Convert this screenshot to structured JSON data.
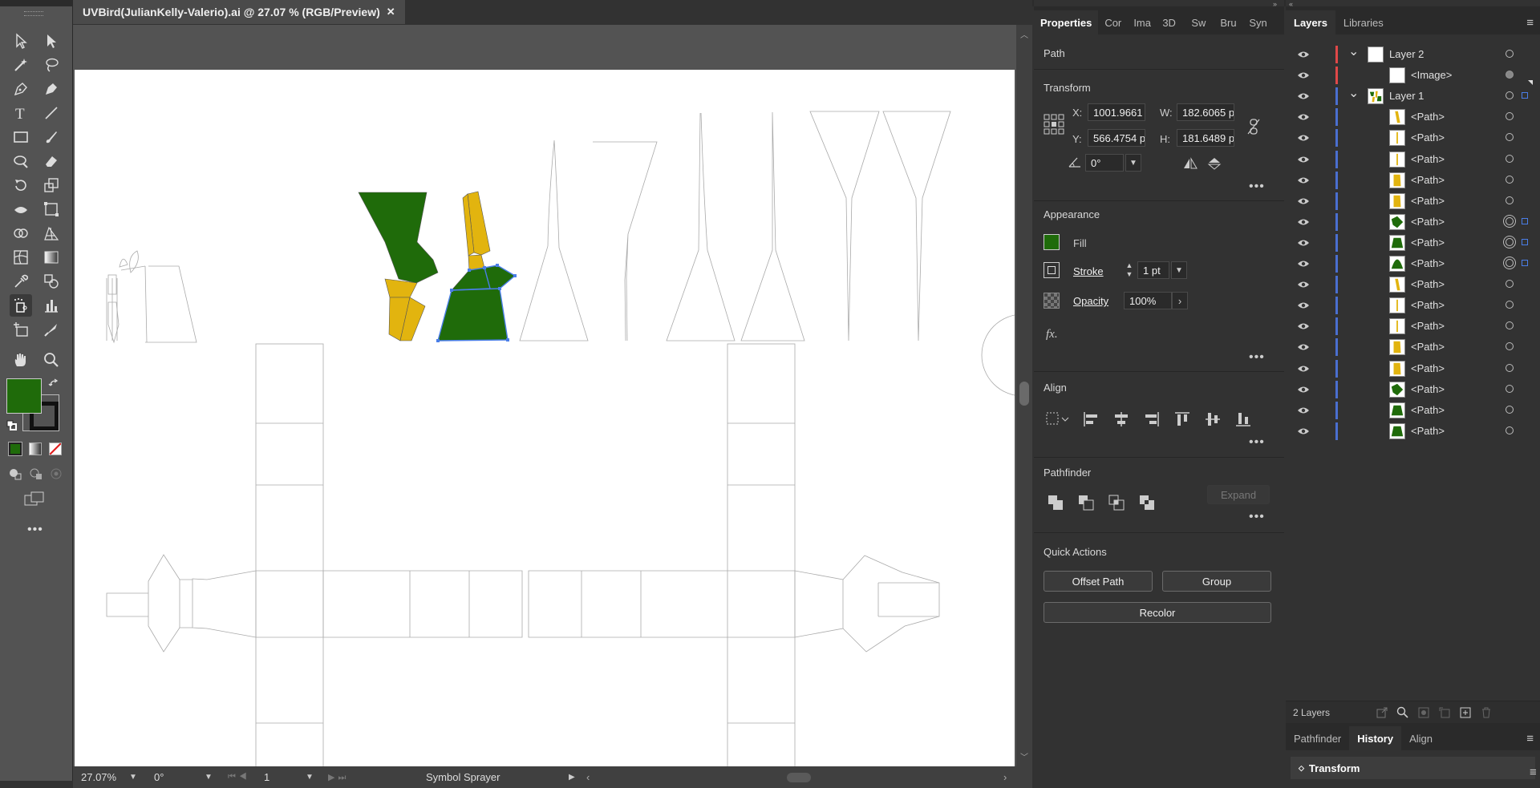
{
  "document": {
    "tab_title": "UVBird(JulianKelly-Valerio).ai @ 27.07 % (RGB/Preview)",
    "close_glyph": "✕"
  },
  "colors": {
    "fill": "#1f6b0a",
    "yellow": "#e2b40f",
    "layer2": "#e04848",
    "layer1": "#4a6fd0",
    "selection": "#4a7ee8"
  },
  "status": {
    "zoom": "27.07%",
    "rotation": "0°",
    "artboard": "1",
    "tool": "Symbol Sprayer"
  },
  "properties": {
    "tabs": [
      "Properties",
      "Cor",
      "Ima",
      "3D",
      "Sw",
      "Bru",
      "Syn"
    ],
    "object_type": "Path",
    "transform": {
      "title": "Transform",
      "x_label": "X:",
      "x": "1001.9661",
      "y_label": "Y:",
      "y": "566.4754 p",
      "w_label": "W:",
      "w": "182.6065 p",
      "h_label": "H:",
      "h": "181.6489 p",
      "angle": "0°"
    },
    "appearance": {
      "title": "Appearance",
      "fill_label": "Fill",
      "stroke_label": "Stroke",
      "stroke_value": "1 pt",
      "opacity_label": "Opacity",
      "opacity_value": "100%",
      "fx": "fx."
    },
    "align": {
      "title": "Align"
    },
    "pathfinder": {
      "title": "Pathfinder",
      "expand": "Expand"
    },
    "quick_actions": {
      "title": "Quick Actions",
      "offset_path": "Offset Path",
      "group": "Group",
      "recolor": "Recolor"
    },
    "more": "•••"
  },
  "layers": {
    "tabs": [
      "Layers",
      "Libraries"
    ],
    "rows": [
      {
        "name": "Layer 2",
        "kind": "layer",
        "color": "layer2",
        "thumb": "white",
        "expanded": true
      },
      {
        "name": "<Image>",
        "kind": "item",
        "color": "layer2",
        "thumb": "white",
        "target": "filled"
      },
      {
        "name": "Layer 1",
        "kind": "layer",
        "color": "layer1",
        "thumb": "mixed",
        "expanded": true,
        "selected": true
      },
      {
        "name": "<Path>",
        "kind": "item",
        "color": "layer1",
        "thumb": "yellow-sliver"
      },
      {
        "name": "<Path>",
        "kind": "item",
        "color": "layer1",
        "thumb": "yellow-line"
      },
      {
        "name": "<Path>",
        "kind": "item",
        "color": "layer1",
        "thumb": "yellow-line"
      },
      {
        "name": "<Path>",
        "kind": "item",
        "color": "layer1",
        "thumb": "yellow-block"
      },
      {
        "name": "<Path>",
        "kind": "item",
        "color": "layer1",
        "thumb": "yellow-block"
      },
      {
        "name": "<Path>",
        "kind": "item",
        "color": "layer1",
        "thumb": "green-shape",
        "target": "selected",
        "selected": true
      },
      {
        "name": "<Path>",
        "kind": "item",
        "color": "layer1",
        "thumb": "green-trap",
        "target": "selected",
        "selected": true
      },
      {
        "name": "<Path>",
        "kind": "item",
        "color": "layer1",
        "thumb": "green-hill",
        "target": "selected",
        "selected": true
      },
      {
        "name": "<Path>",
        "kind": "item",
        "color": "layer1",
        "thumb": "yellow-sliver"
      },
      {
        "name": "<Path>",
        "kind": "item",
        "color": "layer1",
        "thumb": "yellow-line"
      },
      {
        "name": "<Path>",
        "kind": "item",
        "color": "layer1",
        "thumb": "yellow-line"
      },
      {
        "name": "<Path>",
        "kind": "item",
        "color": "layer1",
        "thumb": "yellow-block"
      },
      {
        "name": "<Path>",
        "kind": "item",
        "color": "layer1",
        "thumb": "yellow-block"
      },
      {
        "name": "<Path>",
        "kind": "item",
        "color": "layer1",
        "thumb": "green-shape"
      },
      {
        "name": "<Path>",
        "kind": "item",
        "color": "layer1",
        "thumb": "green-trap"
      },
      {
        "name": "<Path>",
        "kind": "item",
        "color": "layer1",
        "thumb": "green-trap"
      }
    ],
    "count_label": "2 Layers",
    "bottom_tabs": [
      "Pathfinder",
      "History",
      "Align"
    ],
    "history_item": "Transform"
  }
}
